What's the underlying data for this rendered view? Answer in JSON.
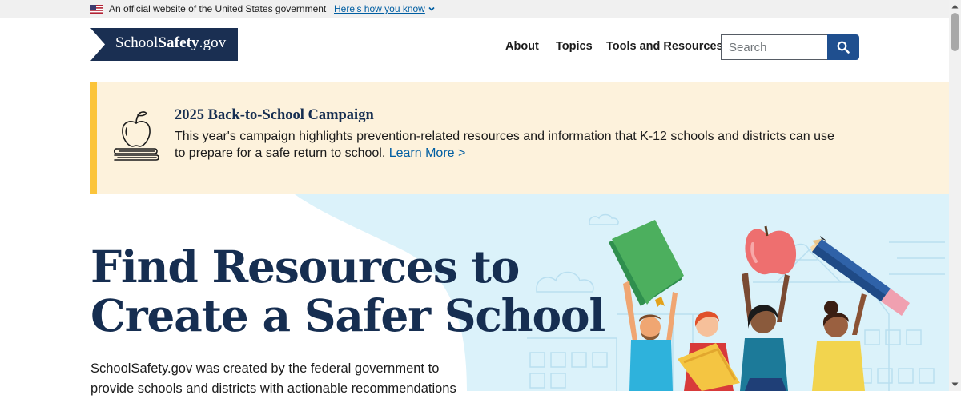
{
  "gov_banner": {
    "official_text": "An official website of the United States government",
    "how_you_know": "Here’s how you know"
  },
  "header": {
    "logo_prefix": "School",
    "logo_bold": "Safety",
    "logo_suffix": ".gov",
    "nav": [
      {
        "label": "About"
      },
      {
        "label": "Topics"
      },
      {
        "label": "Tools and Resources"
      }
    ],
    "search_placeholder": "Search"
  },
  "alert": {
    "title": "2025 Back-to-School Campaign",
    "body": "This year's campaign highlights prevention-related resources and information that K-12 schools and districts can use to prepare for a safe return to school.",
    "link": "Learn More >"
  },
  "hero": {
    "title_line1": "Find Resources to",
    "title_line2": "Create a Safer School",
    "intro": "SchoolSafety.gov was created by the federal government to provide schools and districts with actionable recommendations"
  },
  "colors": {
    "navy": "#162e51",
    "logo_bg": "#1a2f52",
    "search_button": "#1f4f8f",
    "link": "#005ea2",
    "alert_bg": "#fdf2dc",
    "alert_bar": "#fbc43a",
    "hero_blue": "#dbf2fa"
  },
  "icons": {
    "flag": "us-flag-icon",
    "chevron": "chevron-down-icon",
    "search": "search-icon",
    "alert": "apple-on-books-icon"
  }
}
